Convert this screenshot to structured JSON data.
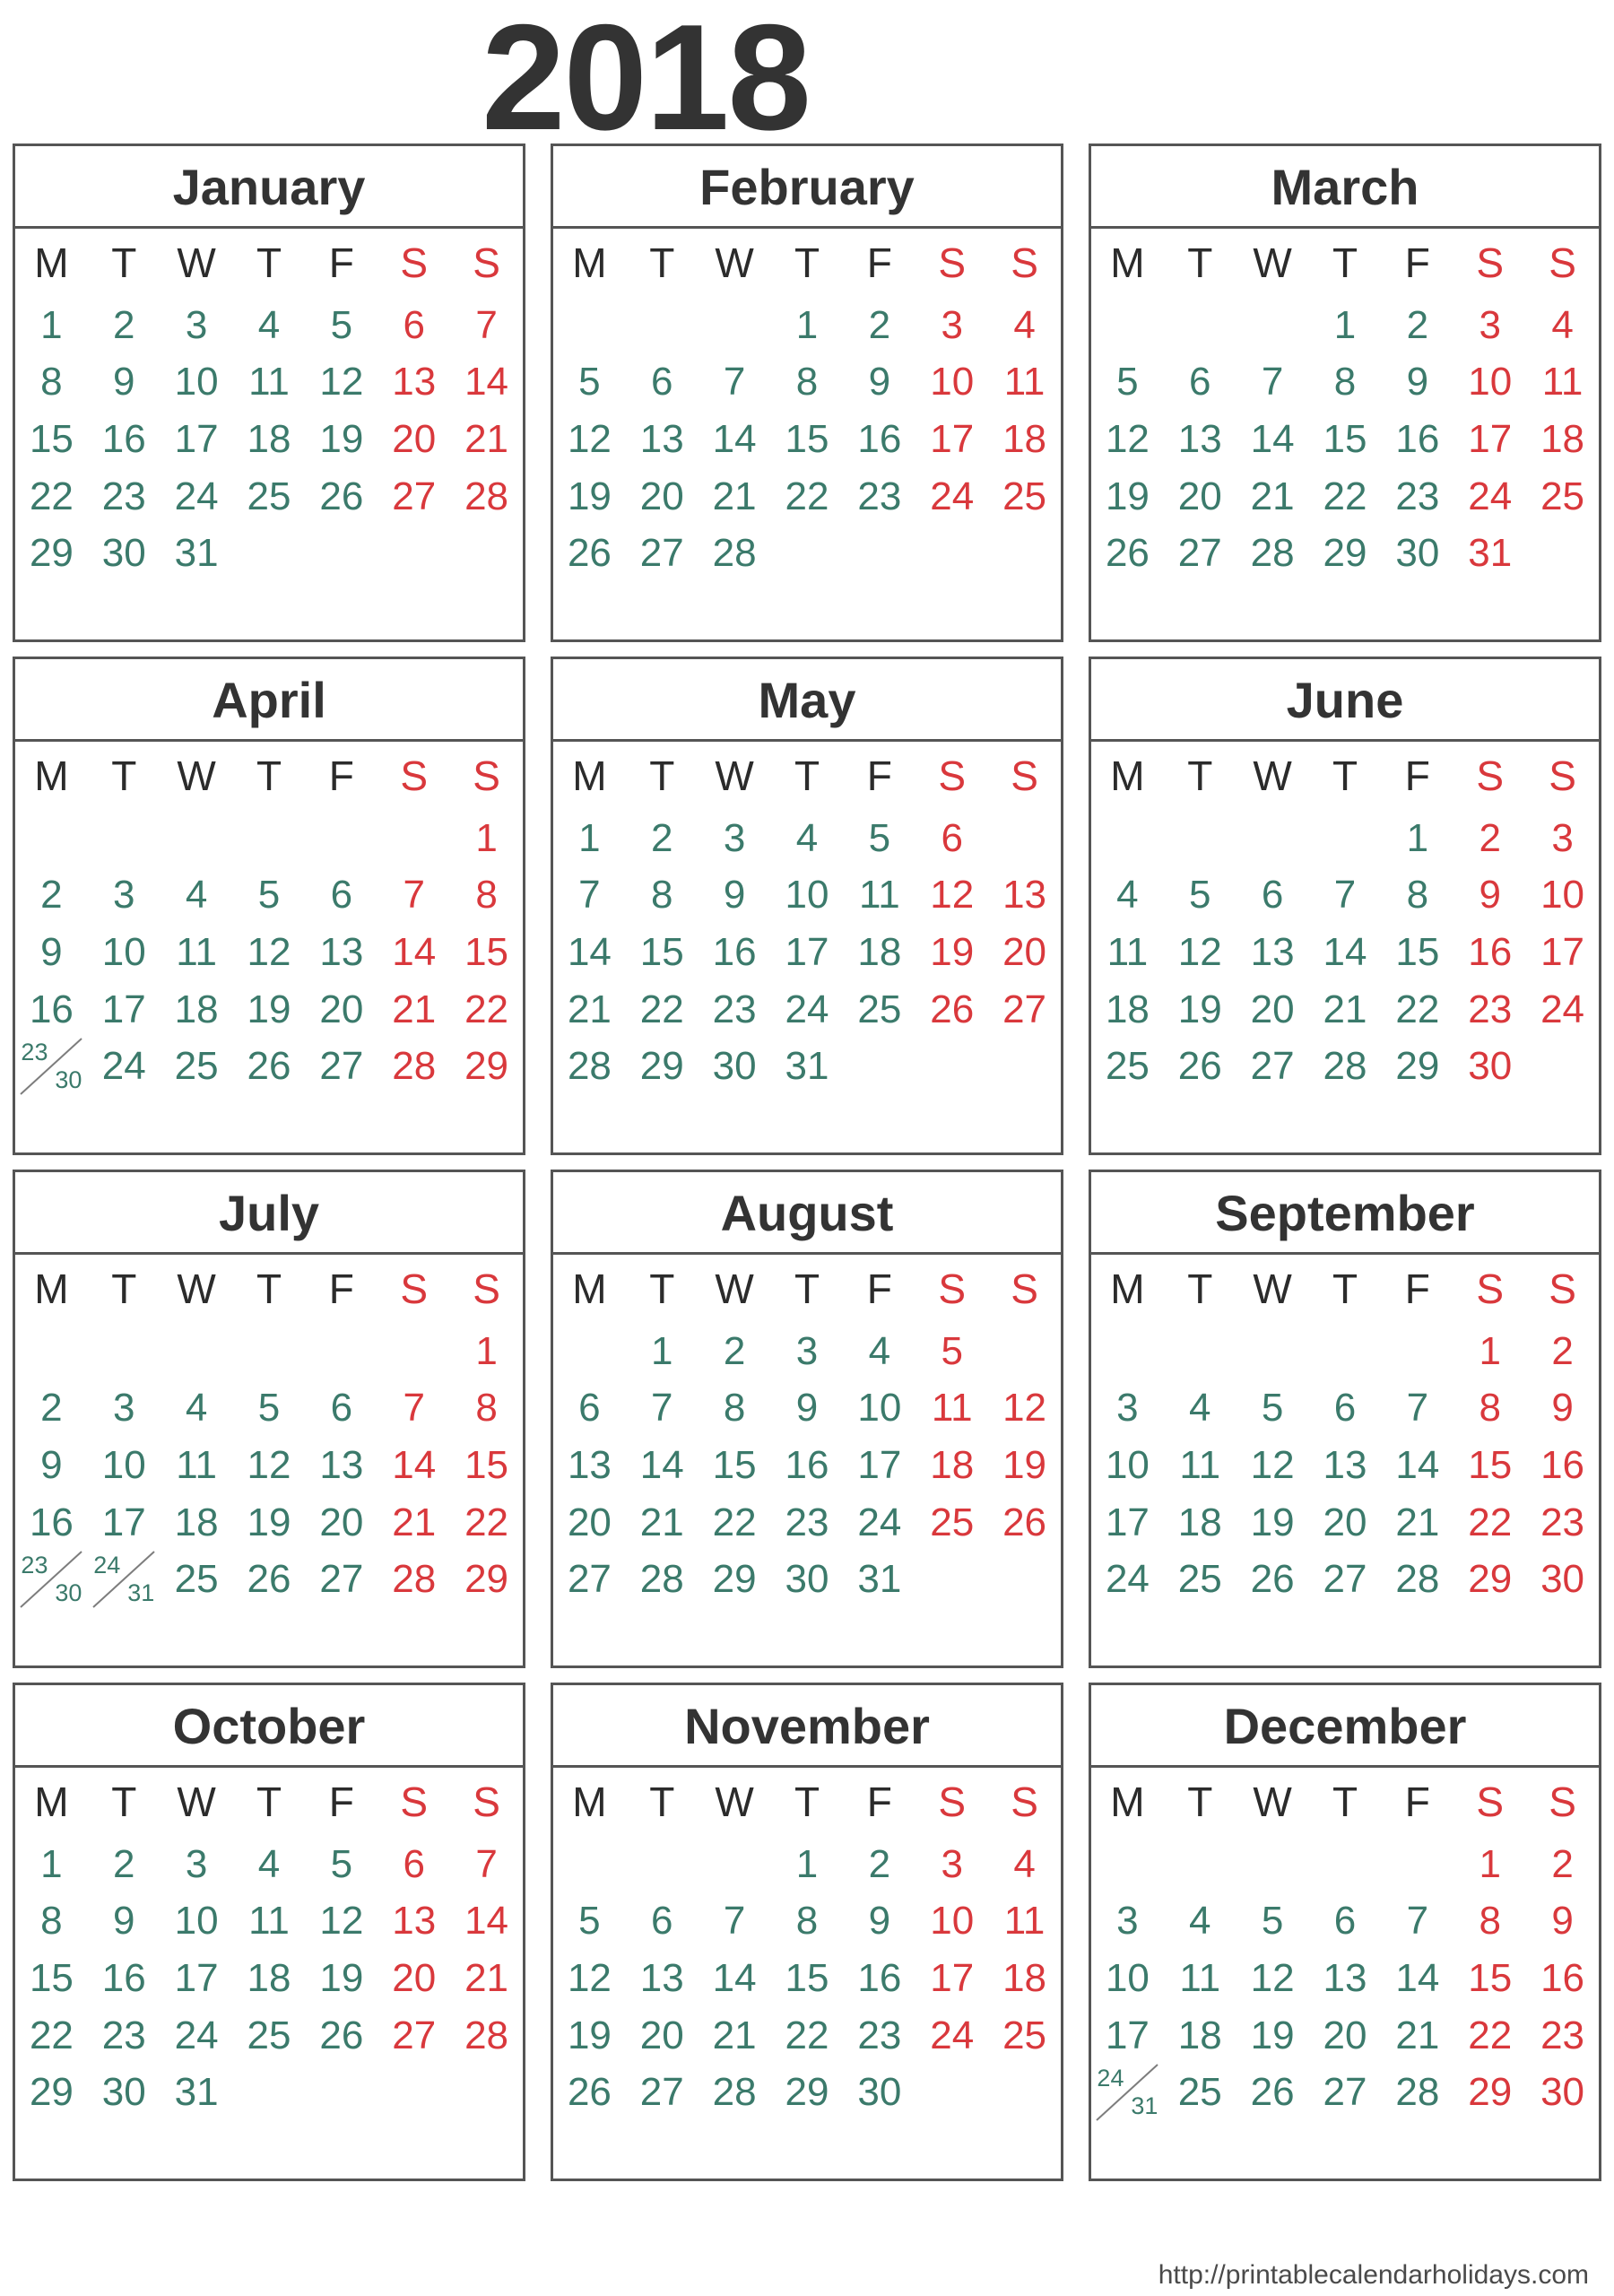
{
  "year_title": "2018",
  "footer": {
    "url": "http://printablecalendarholidays.com"
  },
  "colors": {
    "weekday_text": "#3b7a6b",
    "weekend_text": "#d9383c",
    "header_text": "#333333",
    "border": "#555555",
    "background": "#ffffff"
  },
  "weekday_headers": [
    {
      "label": "M",
      "weekend": false
    },
    {
      "label": "T",
      "weekend": false
    },
    {
      "label": "W",
      "weekend": false
    },
    {
      "label": "T",
      "weekend": false
    },
    {
      "label": "F",
      "weekend": false
    },
    {
      "label": "S",
      "weekend": true
    },
    {
      "label": "S",
      "weekend": true
    }
  ],
  "months": [
    {
      "name": "January",
      "weeks": [
        [
          "1",
          "2",
          "3",
          "4",
          "5",
          "6",
          "7"
        ],
        [
          "8",
          "9",
          "10",
          "11",
          "12",
          "13",
          "14"
        ],
        [
          "15",
          "16",
          "17",
          "18",
          "19",
          "20",
          "21"
        ],
        [
          "22",
          "23",
          "24",
          "25",
          "26",
          "27",
          "28"
        ],
        [
          "29",
          "30",
          "31",
          "",
          "",
          "",
          ""
        ],
        [
          "",
          "",
          "",
          "",
          "",
          "",
          ""
        ]
      ]
    },
    {
      "name": "February",
      "weeks": [
        [
          "",
          "",
          "",
          "1",
          "2",
          "3",
          "4"
        ],
        [
          "5",
          "6",
          "7",
          "8",
          "9",
          "10",
          "11"
        ],
        [
          "12",
          "13",
          "14",
          "15",
          "16",
          "17",
          "18"
        ],
        [
          "19",
          "20",
          "21",
          "22",
          "23",
          "24",
          "25"
        ],
        [
          "26",
          "27",
          "28",
          "",
          "",
          "",
          ""
        ],
        [
          "",
          "",
          "",
          "",
          "",
          "",
          ""
        ]
      ]
    },
    {
      "name": "March",
      "weeks": [
        [
          "",
          "",
          "",
          "1",
          "2",
          "3",
          "4"
        ],
        [
          "5",
          "6",
          "7",
          "8",
          "9",
          "10",
          "11"
        ],
        [
          "12",
          "13",
          "14",
          "15",
          "16",
          "17",
          "18"
        ],
        [
          "19",
          "20",
          "21",
          "22",
          "23",
          "24",
          "25"
        ],
        [
          "26",
          "27",
          "28",
          "29",
          "30",
          "31",
          ""
        ],
        [
          "",
          "",
          "",
          "",
          "",
          "",
          ""
        ]
      ]
    },
    {
      "name": "April",
      "weeks": [
        [
          "",
          "",
          "",
          "",
          "",
          "",
          "1"
        ],
        [
          "2",
          "3",
          "4",
          "5",
          "6",
          "7",
          "8"
        ],
        [
          "9",
          "10",
          "11",
          "12",
          "13",
          "14",
          "15"
        ],
        [
          "16",
          "17",
          "18",
          "19",
          "20",
          "21",
          "22"
        ],
        [
          "23/30",
          "24",
          "25",
          "26",
          "27",
          "28",
          "29"
        ],
        [
          "",
          "",
          "",
          "",
          "",
          "",
          ""
        ]
      ]
    },
    {
      "name": "May",
      "weeks": [
        [
          "1",
          "2",
          "3",
          "4",
          "5",
          "6",
          ""
        ],
        [
          "7",
          "8",
          "9",
          "10",
          "11",
          "12",
          "13"
        ],
        [
          "14",
          "15",
          "16",
          "17",
          "18",
          "19",
          "20"
        ],
        [
          "21",
          "22",
          "23",
          "24",
          "25",
          "26",
          "27"
        ],
        [
          "28",
          "29",
          "30",
          "31",
          "",
          "",
          ""
        ],
        [
          "",
          "",
          "",
          "",
          "",
          "",
          ""
        ]
      ]
    },
    {
      "name": "June",
      "weeks": [
        [
          "",
          "",
          "",
          "",
          "1",
          "2",
          "3"
        ],
        [
          "4",
          "5",
          "6",
          "7",
          "8",
          "9",
          "10"
        ],
        [
          "11",
          "12",
          "13",
          "14",
          "15",
          "16",
          "17"
        ],
        [
          "18",
          "19",
          "20",
          "21",
          "22",
          "23",
          "24"
        ],
        [
          "25",
          "26",
          "27",
          "28",
          "29",
          "30",
          ""
        ],
        [
          "",
          "",
          "",
          "",
          "",
          "",
          ""
        ]
      ]
    },
    {
      "name": "July",
      "weeks": [
        [
          "",
          "",
          "",
          "",
          "",
          "",
          "1"
        ],
        [
          "2",
          "3",
          "4",
          "5",
          "6",
          "7",
          "8"
        ],
        [
          "9",
          "10",
          "11",
          "12",
          "13",
          "14",
          "15"
        ],
        [
          "16",
          "17",
          "18",
          "19",
          "20",
          "21",
          "22"
        ],
        [
          "23/30",
          "24/31",
          "25",
          "26",
          "27",
          "28",
          "29"
        ],
        [
          "",
          "",
          "",
          "",
          "",
          "",
          ""
        ]
      ]
    },
    {
      "name": "August",
      "weeks": [
        [
          "",
          "1",
          "2",
          "3",
          "4",
          "5",
          ""
        ],
        [
          "6",
          "7",
          "8",
          "9",
          "10",
          "11",
          "12"
        ],
        [
          "13",
          "14",
          "15",
          "16",
          "17",
          "18",
          "19"
        ],
        [
          "20",
          "21",
          "22",
          "23",
          "24",
          "25",
          "26"
        ],
        [
          "27",
          "28",
          "29",
          "30",
          "31",
          "",
          ""
        ],
        [
          "",
          "",
          "",
          "",
          "",
          "",
          ""
        ]
      ]
    },
    {
      "name": "September",
      "weeks": [
        [
          "",
          "",
          "",
          "",
          "",
          "1",
          "2"
        ],
        [
          "3",
          "4",
          "5",
          "6",
          "7",
          "8",
          "9"
        ],
        [
          "10",
          "11",
          "12",
          "13",
          "14",
          "15",
          "16"
        ],
        [
          "17",
          "18",
          "19",
          "20",
          "21",
          "22",
          "23"
        ],
        [
          "24",
          "25",
          "26",
          "27",
          "28",
          "29",
          "30"
        ],
        [
          "",
          "",
          "",
          "",
          "",
          "",
          ""
        ]
      ]
    },
    {
      "name": "October",
      "weeks": [
        [
          "1",
          "2",
          "3",
          "4",
          "5",
          "6",
          "7"
        ],
        [
          "8",
          "9",
          "10",
          "11",
          "12",
          "13",
          "14"
        ],
        [
          "15",
          "16",
          "17",
          "18",
          "19",
          "20",
          "21"
        ],
        [
          "22",
          "23",
          "24",
          "25",
          "26",
          "27",
          "28"
        ],
        [
          "29",
          "30",
          "31",
          "",
          "",
          "",
          ""
        ],
        [
          "",
          "",
          "",
          "",
          "",
          "",
          ""
        ]
      ]
    },
    {
      "name": "November",
      "weeks": [
        [
          "",
          "",
          "",
          "1",
          "2",
          "3",
          "4"
        ],
        [
          "5",
          "6",
          "7",
          "8",
          "9",
          "10",
          "11"
        ],
        [
          "12",
          "13",
          "14",
          "15",
          "16",
          "17",
          "18"
        ],
        [
          "19",
          "20",
          "21",
          "22",
          "23",
          "24",
          "25"
        ],
        [
          "26",
          "27",
          "28",
          "29",
          "30",
          "",
          ""
        ],
        [
          "",
          "",
          "",
          "",
          "",
          "",
          ""
        ]
      ]
    },
    {
      "name": "December",
      "weeks": [
        [
          "",
          "",
          "",
          "",
          "",
          "1",
          "2"
        ],
        [
          "3",
          "4",
          "5",
          "6",
          "7",
          "8",
          "9"
        ],
        [
          "10",
          "11",
          "12",
          "13",
          "14",
          "15",
          "16"
        ],
        [
          "17",
          "18",
          "19",
          "20",
          "21",
          "22",
          "23"
        ],
        [
          "24/31",
          "25",
          "26",
          "27",
          "28",
          "29",
          "30"
        ],
        [
          "",
          "",
          "",
          "",
          "",
          "",
          ""
        ]
      ]
    }
  ]
}
